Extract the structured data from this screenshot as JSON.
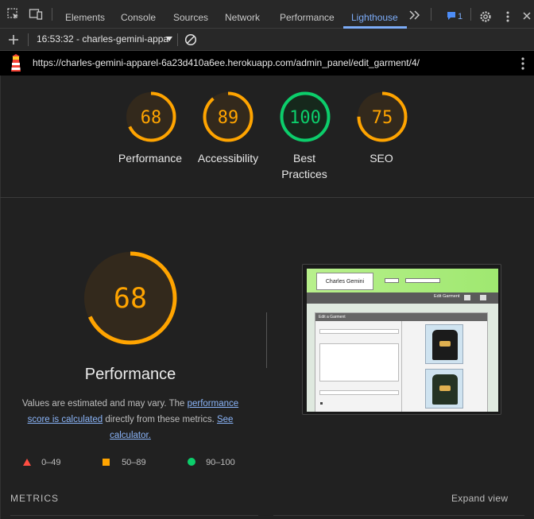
{
  "devtools": {
    "tabs": [
      {
        "label": "Elements"
      },
      {
        "label": "Console"
      },
      {
        "label": "Sources"
      },
      {
        "label": "Network"
      },
      {
        "label": "Performance"
      },
      {
        "label": "Lighthouse"
      }
    ],
    "active_tab": "Lighthouse",
    "issues_count": "1",
    "run_selector": "16:53:32 - charles-gemini-appa",
    "url": "https://charles-gemini-apparel-6a23d410a6ee.herokuapp.com/admin_panel/edit_garment/4/"
  },
  "scores": [
    {
      "value": 68,
      "label": "Performance",
      "color": "#ffa400"
    },
    {
      "value": 89,
      "label": "Accessibility",
      "color": "#ffa400"
    },
    {
      "value": 100,
      "label_line1": "Best",
      "label_line2": "Practices",
      "color": "#0cce6b"
    },
    {
      "value": 75,
      "label": "SEO",
      "color": "#ffa400"
    }
  ],
  "performance": {
    "score": 68,
    "title": "Performance",
    "disclaimer_pre": "Values are estimated and may vary. The ",
    "disclaimer_link1": "performance score is calculated",
    "disclaimer_mid": " directly from these metrics. ",
    "disclaimer_link2": "See calculator."
  },
  "legend": [
    {
      "range": "0–49",
      "color": "#ff4e42",
      "shape": "triangle"
    },
    {
      "range": "50–89",
      "color": "#ffa400",
      "shape": "square"
    },
    {
      "range": "90–100",
      "color": "#0cce6b",
      "shape": "circle"
    }
  ],
  "metrics_label": "METRICS",
  "expand_label": "Expand view",
  "thumbnail": {
    "logo_text": "Charles Gemini",
    "nav_text": "Edit Garment",
    "panel_title": "Edit a Garment"
  }
}
